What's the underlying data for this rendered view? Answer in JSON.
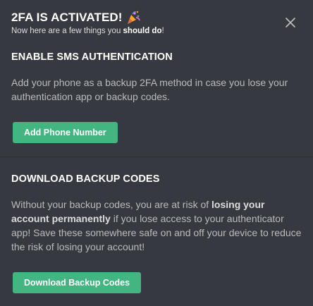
{
  "header": {
    "title": "2FA IS ACTIVATED!",
    "subtitle_prefix": "Now here are a few things you ",
    "subtitle_bold": "should do",
    "subtitle_suffix": "!",
    "title_icon": "party-popper-icon",
    "close_icon": "close-icon"
  },
  "sms": {
    "title": "ENABLE SMS AUTHENTICATION",
    "body": "Add your phone as a backup 2FA method in case you lose your authentication app or backup codes.",
    "button_label": "Add Phone Number"
  },
  "backup": {
    "title": "DOWNLOAD BACKUP CODES",
    "body_prefix": "Without your backup codes, you are at risk of ",
    "body_bold": "losing your account permanently",
    "body_suffix": " if you lose access to your authenticator app! Save these somewhere safe on and off your device to reduce the risk of losing your account!",
    "button_label": "Download Backup Codes"
  },
  "colors": {
    "background": "#36393f",
    "button": "#43b581",
    "text_primary": "#ffffff",
    "text_muted": "#b9bbbe"
  }
}
